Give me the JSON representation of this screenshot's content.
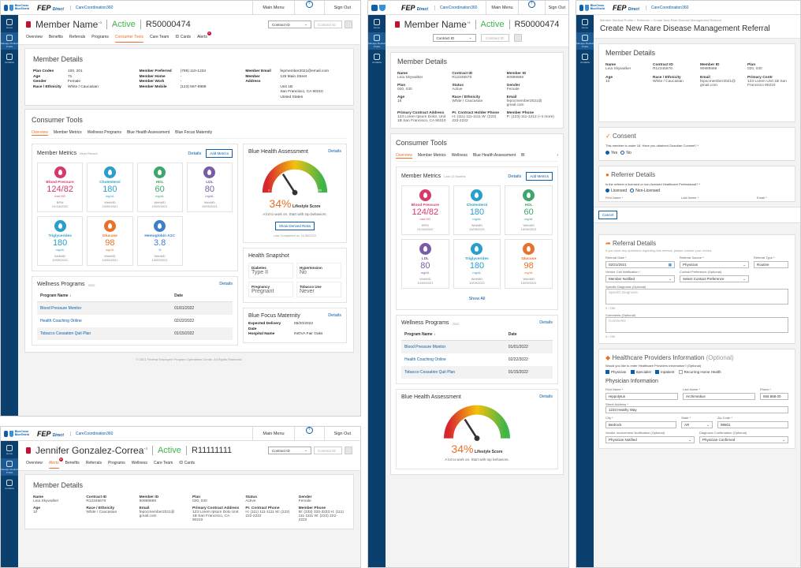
{
  "app": {
    "logo_text": "BlueCross BlueShield",
    "fep": "FEP",
    "direct": "Direct",
    "cc": "CareCoordination360",
    "main_menu": "Main Menu",
    "help": "?",
    "sign_out": "Sign Out"
  },
  "nav": [
    "Home",
    "Manage Medical Profile",
    "Contacts"
  ],
  "p1": {
    "member_name": "Member Name",
    "plus": "+3",
    "status": "Active",
    "member_id": "R50000474",
    "contract_select": "Contract ID",
    "contract_input": "Contract ID",
    "tabs": [
      "Overview",
      "Benefits",
      "Referrals",
      "Programs",
      "Consumer Tools",
      "Care Team",
      "ID Cards",
      "Alerts"
    ],
    "alerts_badge": "5",
    "details_title": "Member Details",
    "col1": [
      [
        "Plan Codes",
        "100, 201"
      ],
      [
        "Age",
        "71"
      ],
      [
        "Gender",
        "Female"
      ],
      [
        "Race / Ethnicity",
        "White / Caucasian"
      ]
    ],
    "col2": [
      [
        "Member Preferred",
        "(789) 110-1234"
      ],
      [
        "Member Home",
        "-"
      ],
      [
        "Member Work",
        "-"
      ],
      [
        "Member Mobile",
        "(123) 567-8989"
      ]
    ],
    "col3": [
      [
        "Member Email",
        "fepmember2021@email.com"
      ],
      [
        "Member Address",
        "125 Main Street"
      ],
      [
        "",
        "Unit 1B"
      ],
      [
        "",
        "San Francisco, CA 90210"
      ],
      [
        "",
        "United States"
      ]
    ],
    "tools_title": "Consumer Tools",
    "tools_tabs": [
      "Overview",
      "Member Metrics",
      "Wellness Programs",
      "Blue Health Assessment",
      "Blue Focus Maternity"
    ],
    "metrics_title": "Member Metrics",
    "metrics_sub": "Most Recent",
    "details": "Details",
    "add_metrics": "Add Metrics",
    "metrics": [
      {
        "name": "Blood Pressure",
        "value": "124/82",
        "unit": "mm HG",
        "src": "BPM",
        "date": "01/15/2022",
        "color": "#d63a6b",
        "vc": "#d63a6b"
      },
      {
        "name": "Cholesterol",
        "value": "180",
        "unit": "mg/dL",
        "src": "WebMD",
        "date": "10/09/2021",
        "color": "#2a9fc9",
        "vc": "#2a9fc9"
      },
      {
        "name": "HDL",
        "value": "60",
        "unit": "mg/dL",
        "src": "WebMD",
        "date": "10/09/2021",
        "color": "#3fa66b",
        "vc": "#3fa66b"
      },
      {
        "name": "LDL",
        "value": "80",
        "unit": "mg/dL",
        "src": "WebMD",
        "date": "10/09/2021",
        "color": "#7a5ba6",
        "vc": "#7a5ba6"
      },
      {
        "name": "Triglycerides",
        "value": "180",
        "unit": "mg/dL",
        "src": "WebMD",
        "date": "10/09/2021",
        "color": "#2a9fc9",
        "vc": "#2a9fc9"
      },
      {
        "name": "Glucose",
        "value": "98",
        "unit": "mg/dL",
        "src": "WebMD",
        "date": "10/09/2021",
        "color": "#e8712b",
        "vc": "#e8712b"
      },
      {
        "name": "Hemoglobin A1C",
        "value": "3.8",
        "unit": "%",
        "src": "WebMD",
        "date": "10/09/2021",
        "color": "#3d7fc9",
        "vc": "#3d7fc9"
      }
    ],
    "bha_title": "Blue Health Assessment",
    "bha_pct": "34%",
    "bha_label": "Lifestyle Score",
    "bha_text": "A lot to work on. Start with top behaviors.",
    "bha_btn": "Show Derived Risks",
    "bha_done": "Last Completed on 11/30/2022",
    "g0": "0",
    "g100": "100",
    "hs_title": "Health Snapshot",
    "hs": [
      [
        "Diabetes",
        "Type II"
      ],
      [
        "Hypertension",
        "No"
      ],
      [
        "Pregnancy",
        "Pregnant"
      ],
      [
        "Tobacco Use",
        "Never"
      ]
    ],
    "wp_title": "Wellness Programs",
    "wp_year": "2022",
    "wp_cols": [
      "Program Name",
      "Date"
    ],
    "wp_rows": [
      [
        "Blood Pressure Monitor",
        "01/01/2022"
      ],
      [
        "Health Coaching Online",
        "02/22/2022"
      ],
      [
        "Tobacco Cessation Quit Plan",
        "01/15/2022"
      ]
    ],
    "bfm_title": "Blue Focus Maternity",
    "bfm": [
      [
        "Expected Delivery Date",
        "06/20/2022"
      ],
      [
        "Hospital Name",
        "INOVA Fair Oaks"
      ]
    ],
    "footer": "© 2021 Federal Employee Program Operations Center. All Rights Reserved."
  },
  "p2": {
    "member_name": "Jennifer Gonzalez-Correa",
    "plus": "+3",
    "status": "Active",
    "member_id": "R11111111",
    "tabs": [
      "Overview",
      "Alerts",
      "Benefits",
      "Referrals",
      "Programs",
      "Wellness",
      "Care Team",
      "ID Cards"
    ],
    "alerts_badge": "15",
    "details_title": "Member Details",
    "cols": [
      [
        [
          "Name",
          "Leia Skywalker"
        ],
        [
          "Age",
          "10"
        ]
      ],
      [
        [
          "Contract ID",
          "R12345678"
        ],
        [
          "Race / Ethnicity",
          "White / Caucasian"
        ]
      ],
      [
        [
          "Member ID",
          "90989888"
        ],
        [
          "Email",
          "fepocmember2021@ gmail.com"
        ]
      ],
      [
        [
          "Plan",
          "020, 030"
        ],
        [
          "Primary Contract Address",
          "123 Lorem Ipsum Dolo Unit 1B San Francisco, CA 90210"
        ]
      ],
      [
        [
          "Status",
          "Active"
        ],
        [
          "Pr. Contract Phone",
          "H: (111) 111-1111 W: (222) 222-2222"
        ]
      ],
      [
        [
          "Gender",
          "Female"
        ],
        [
          "Member Phone",
          "M: (333) 333-3333 H: (111) 111-1111 W: (222) 222-2222"
        ]
      ]
    ]
  },
  "p3": {
    "member_name": "Member Name",
    "plus": "+3",
    "status": "Active",
    "member_id": "R50000474",
    "details_title": "Member Details",
    "grid": [
      [
        "Name",
        "Leia Skywalker"
      ],
      [
        "Contract ID",
        "R12345678"
      ],
      [
        "Member ID",
        "90989888"
      ],
      [
        "Plan",
        "020, 030"
      ],
      [
        "Status",
        "Active"
      ],
      [
        "Gender",
        "Female"
      ],
      [
        "Age",
        "18"
      ],
      [
        "Race / Ethnicity",
        "White / Caucasian"
      ],
      [
        "Email",
        "fepocmember2021@ gmail.com"
      ],
      [
        "Primary Contract Address",
        "123 Lorem Ipsum Dolor, Unit 1B San Francisco, CA 90210"
      ],
      [
        "Pr. Contract Holder Phone",
        "H: (111) 111-1111 W: (222) 222-2222"
      ],
      [
        "Member Phone",
        "P: (123) 111-1212 (+4 more)"
      ]
    ],
    "tools_title": "Consumer Tools",
    "tools_tabs": [
      "Overview",
      "Member Metrics",
      "Wellness",
      "Blue Health Assessment",
      "Bl"
    ],
    "metrics_title": "Member Metrics",
    "metrics_sub": "Last 12 Months",
    "show_all": "Show All",
    "wp_title": "Wellness Programs",
    "wp_year": "2022",
    "bha_title": "Blue Health Assessment",
    "bha_pct": "34%",
    "bha_label": "Lifestyle Score",
    "bha_text": "A lot to work on. Start with top behaviors."
  },
  "p4": {
    "breadcrumb": "Member Medical Profile  >  Referrals  >  Create New Rare Disease Management Referral",
    "title": "Create New Rare Disease Management Referral",
    "details_title": "Member Details",
    "grid": [
      [
        "Name",
        "Leia Skywalker"
      ],
      [
        "Contract ID",
        "R12345678"
      ],
      [
        "Member ID",
        "90989888"
      ],
      [
        "Plan",
        "020, 030"
      ],
      [
        "Age",
        "10"
      ],
      [
        "Race / Ethnicity",
        "White / Caucasian"
      ],
      [
        "Email",
        "fepocmember2021@ gmail.com"
      ],
      [
        "Primary Contr",
        "123 Lorem Unit 1B San Francisco 90210"
      ]
    ],
    "consent_title": "Consent",
    "consent_q": "This member is under 18. Have you obtained Guardian Consent? *",
    "yes": "Yes",
    "no": "No",
    "ref_title": "Referrer Details",
    "ref_q": "Is the referrer a licensed or non-licensed Healthcare Professional? *",
    "licensed": "Licensed",
    "nonlicensed": "Non-Licensed",
    "first": "First Name *",
    "last": "Last Name *",
    "email": "Email *",
    "first_v": "Maria",
    "last_v": "Sharapova",
    "email_v": "msharapova@",
    "cancel": "Cancel",
    "rd_title": "Referral Details",
    "rd_sub": "If you have any questions regarding this referral, please contact your vendor.",
    "rdate": "Referral Date *",
    "rdate_v": "02/21/2021",
    "rsrc": "Referral Source *",
    "rsrc_v": "Physician",
    "rtype": "Referral Type *",
    "rtype_v": "Routine",
    "vnotif": "Vendor Call Notification *",
    "vnotif_v": "Member Notified",
    "cpref": "Contact Preference (Optional)",
    "cpref_v": "Select Contact Preference",
    "diag": "Specific Diagnosis (Optional)",
    "diag_ph": "Specific Diagnosis",
    "count1": "0 / 250",
    "comments": "Comments (Optional)",
    "comments_ph": "Comments",
    "count2": "0 / 250",
    "hp_title": "Healthcare Providers Information",
    "hp_opt": "(Optional)",
    "hp_q": "Would you like to enter Healthcare Providers Information? (Optional)",
    "hp_checks": [
      "Physician",
      "Specialist",
      "Inpatient",
      "Recurring Home Health"
    ],
    "pi_title": "Physician Information",
    "pfirst": "First Name *",
    "pfirst_v": "Hippolytus",
    "plast": "Last Name *",
    "plast_v": "Archimedius",
    "phone": "Phone *",
    "phone_v": "555.888.00",
    "street": "Street Address *",
    "street_v": "1234 Heathy Way",
    "city": "City *",
    "city_v": "Bedrock",
    "state": "State *",
    "state_v": "AR",
    "zip": "Zip Code *",
    "zip_v": "98501",
    "vinv": "Vendor Involvement Notification (Optional)",
    "vinv_v": "Physician Notified",
    "dconf": "Diagnosis Confirmation (Optional)",
    "dconf_v": "Physician Confirmed"
  }
}
